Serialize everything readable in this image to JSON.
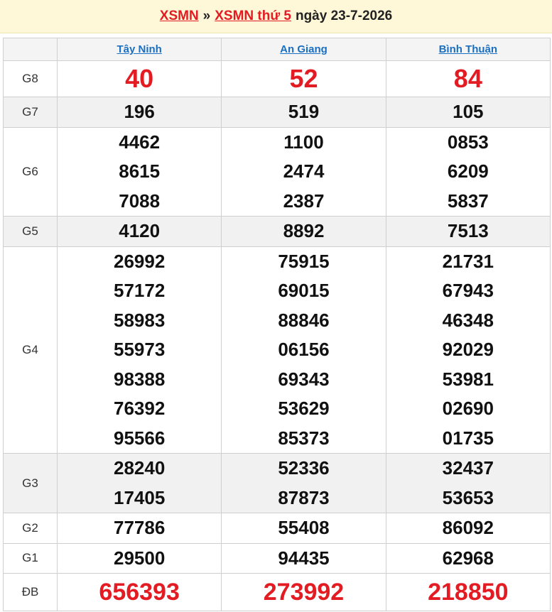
{
  "header": {
    "link1": "XSMN",
    "separator": "»",
    "link2": "XSMN thứ 5",
    "date_text": "ngày 23-7-2026"
  },
  "columns": [
    "Tây Ninh",
    "An Giang",
    "Bình Thuận"
  ],
  "rows": [
    {
      "label": "G8",
      "style": "big",
      "alt": false,
      "cells": [
        [
          "40"
        ],
        [
          "52"
        ],
        [
          "84"
        ]
      ]
    },
    {
      "label": "G7",
      "style": "num",
      "alt": true,
      "cells": [
        [
          "196"
        ],
        [
          "519"
        ],
        [
          "105"
        ]
      ]
    },
    {
      "label": "G6",
      "style": "num",
      "alt": false,
      "cells": [
        [
          "4462",
          "8615",
          "7088"
        ],
        [
          "1100",
          "2474",
          "2387"
        ],
        [
          "0853",
          "6209",
          "5837"
        ]
      ]
    },
    {
      "label": "G5",
      "style": "num",
      "alt": true,
      "cells": [
        [
          "4120"
        ],
        [
          "8892"
        ],
        [
          "7513"
        ]
      ]
    },
    {
      "label": "G4",
      "style": "num",
      "alt": false,
      "cells": [
        [
          "26992",
          "57172",
          "58983",
          "55973",
          "98388",
          "76392",
          "95566"
        ],
        [
          "75915",
          "69015",
          "88846",
          "06156",
          "69343",
          "53629",
          "85373"
        ],
        [
          "21731",
          "67943",
          "46348",
          "92029",
          "53981",
          "02690",
          "01735"
        ]
      ]
    },
    {
      "label": "G3",
      "style": "num",
      "alt": true,
      "cells": [
        [
          "28240",
          "17405"
        ],
        [
          "52336",
          "87873"
        ],
        [
          "32437",
          "53653"
        ]
      ]
    },
    {
      "label": "G2",
      "style": "num",
      "alt": false,
      "cells": [
        [
          "77786"
        ],
        [
          "55408"
        ],
        [
          "86092"
        ]
      ]
    },
    {
      "label": "G1",
      "style": "num",
      "alt": false,
      "cells": [
        [
          "29500"
        ],
        [
          "94435"
        ],
        [
          "62968"
        ]
      ]
    },
    {
      "label": "ĐB",
      "style": "big",
      "alt": false,
      "cells": [
        [
          "656393"
        ],
        [
          "273992"
        ],
        [
          "218850"
        ]
      ]
    }
  ],
  "colors": {
    "accent_red": "#e31b23",
    "link_blue": "#1a6fc0",
    "header_bg": "#fff8d8"
  }
}
